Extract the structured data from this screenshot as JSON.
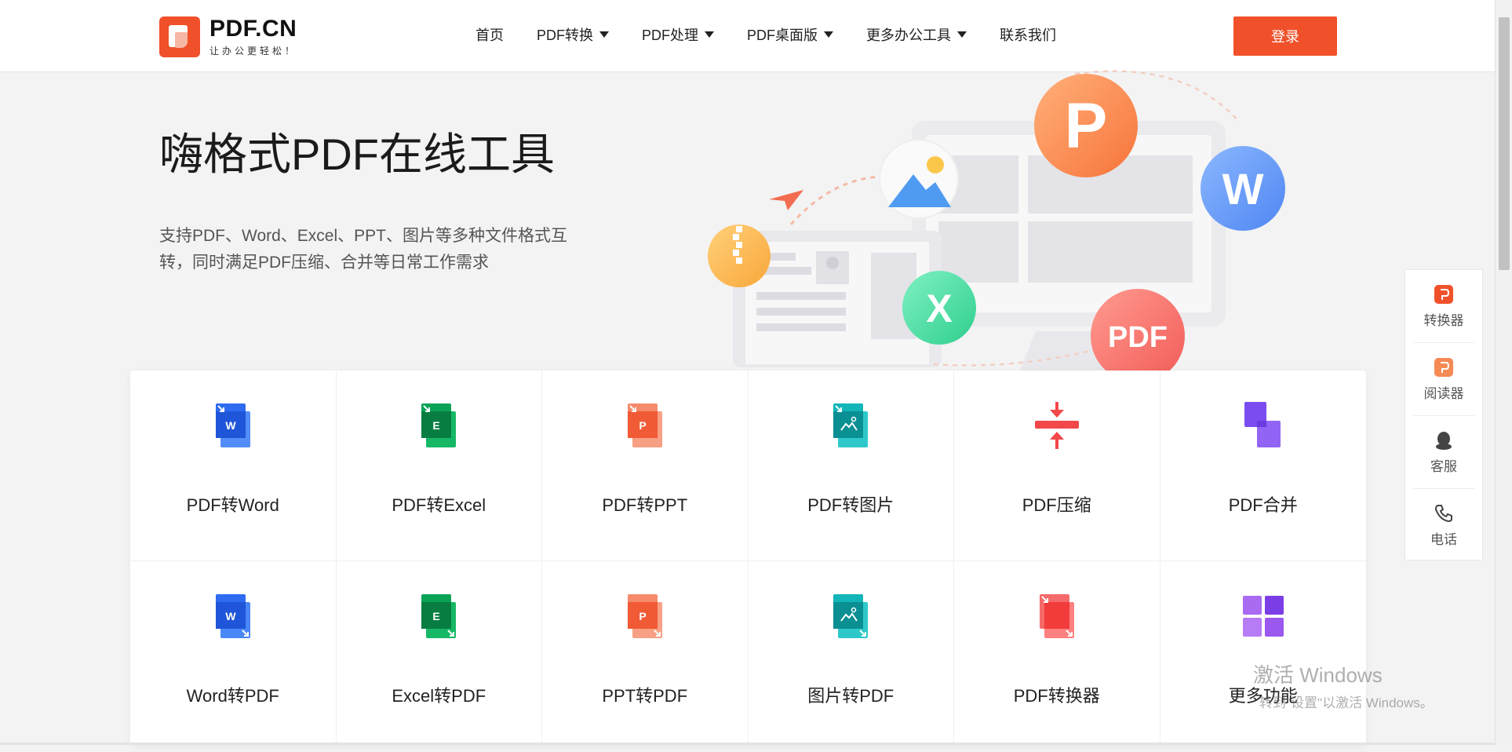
{
  "logo": {
    "title": "PDF.CN",
    "subtitle": "让办公更轻松！"
  },
  "nav": {
    "items": [
      {
        "label": "首页",
        "dropdown": false
      },
      {
        "label": "PDF转换",
        "dropdown": true
      },
      {
        "label": "PDF处理",
        "dropdown": true
      },
      {
        "label": "PDF桌面版",
        "dropdown": true
      },
      {
        "label": "更多办公工具",
        "dropdown": true
      },
      {
        "label": "联系我们",
        "dropdown": false
      }
    ],
    "login_label": "登录"
  },
  "hero": {
    "title": "嗨格式PDF在线工具",
    "description": "支持PDF、Word、Excel、PPT、图片等多种文件格式互转，同时满足PDF压缩、合并等日常工作需求"
  },
  "illustration": {
    "badges": [
      "P",
      "W",
      "X",
      "PDF"
    ]
  },
  "tools": [
    {
      "label": "PDF转Word",
      "icon": "word-doc-icon",
      "letter": "W"
    },
    {
      "label": "PDF转Excel",
      "icon": "excel-doc-icon",
      "letter": "E"
    },
    {
      "label": "PDF转PPT",
      "icon": "ppt-doc-icon",
      "letter": "P"
    },
    {
      "label": "PDF转图片",
      "icon": "image-doc-icon",
      "letter": ""
    },
    {
      "label": "PDF压缩",
      "icon": "compress-icon",
      "letter": ""
    },
    {
      "label": "PDF合并",
      "icon": "merge-icon",
      "letter": ""
    },
    {
      "label": "Word转PDF",
      "icon": "word-doc-icon",
      "letter": "W"
    },
    {
      "label": "Excel转PDF",
      "icon": "excel-doc-icon",
      "letter": "E"
    },
    {
      "label": "PPT转PDF",
      "icon": "ppt-doc-icon",
      "letter": "P"
    },
    {
      "label": "图片转PDF",
      "icon": "image-doc-icon",
      "letter": ""
    },
    {
      "label": "PDF转换器",
      "icon": "converter-icon",
      "letter": ""
    },
    {
      "label": "更多功能",
      "icon": "grid-icon",
      "letter": ""
    }
  ],
  "side_float": {
    "items": [
      {
        "label": "转换器",
        "icon": "converter-app-icon"
      },
      {
        "label": "阅读器",
        "icon": "reader-app-icon"
      },
      {
        "label": "客服",
        "icon": "qq-icon"
      },
      {
        "label": "电话",
        "icon": "phone-icon"
      }
    ]
  },
  "watermark": {
    "line1": "激活 Windows",
    "line2": "转到\"设置\"以激活 Windows。"
  },
  "colors": {
    "brand": "#f0512a",
    "word": "#2e6bf0",
    "excel": "#0aa356",
    "ppt": "#f05a35",
    "image": "#12b5b8",
    "compress": "#f2484a",
    "merge": "#7b4df0"
  }
}
